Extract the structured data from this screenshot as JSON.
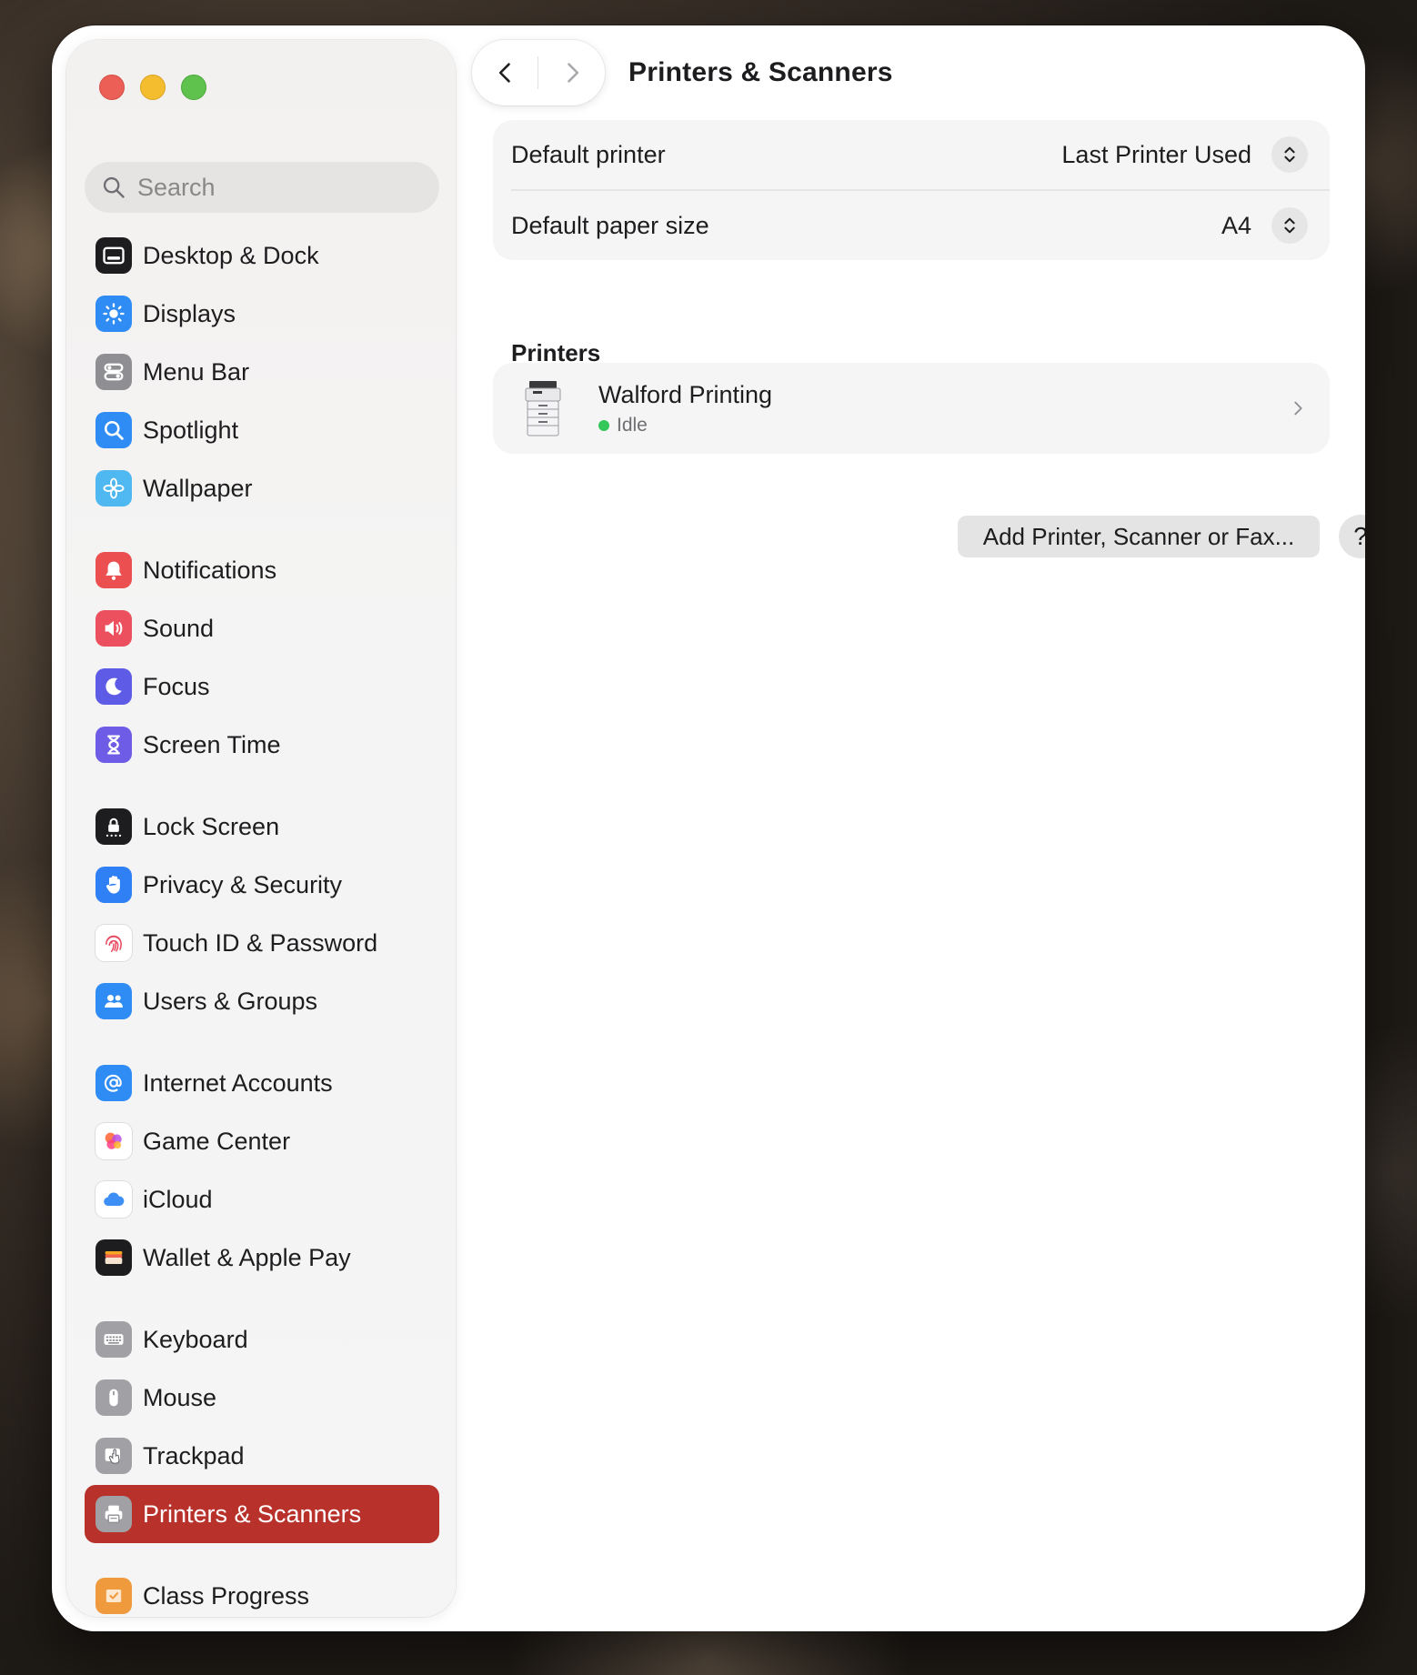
{
  "window": {
    "title": "Printers & Scanners"
  },
  "search": {
    "placeholder": "Search"
  },
  "sidebar": {
    "items": [
      {
        "label": "Desktop & Dock",
        "icon": "desktop-dock-icon",
        "color": "#1d1d1f"
      },
      {
        "label": "Displays",
        "icon": "displays-icon",
        "color": "#2f8cf5"
      },
      {
        "label": "Menu Bar",
        "icon": "menu-bar-icon",
        "color": "#8e8e93"
      },
      {
        "label": "Spotlight",
        "icon": "spotlight-icon",
        "color": "#2f8cf5"
      },
      {
        "label": "Wallpaper",
        "icon": "wallpaper-icon",
        "color": "#4fb8f0"
      },
      {
        "label": "Notifications",
        "icon": "notifications-icon",
        "color": "#ec4f4f"
      },
      {
        "label": "Sound",
        "icon": "sound-icon",
        "color": "#ec4f5d"
      },
      {
        "label": "Focus",
        "icon": "focus-icon",
        "color": "#5e5ce6"
      },
      {
        "label": "Screen Time",
        "icon": "screen-time-icon",
        "color": "#6e5ce6"
      },
      {
        "label": "Lock Screen",
        "icon": "lock-screen-icon",
        "color": "#1d1d1f"
      },
      {
        "label": "Privacy & Security",
        "icon": "privacy-hand-icon",
        "color": "#2f7ff5"
      },
      {
        "label": "Touch ID & Password",
        "icon": "fingerprint-icon",
        "color": "#ffffff"
      },
      {
        "label": "Users & Groups",
        "icon": "users-groups-icon",
        "color": "#2f8cf5"
      },
      {
        "label": "Internet Accounts",
        "icon": "at-sign-icon",
        "color": "#2f8cf5"
      },
      {
        "label": "Game Center",
        "icon": "game-center-icon",
        "color": "#ffffff"
      },
      {
        "label": "iCloud",
        "icon": "icloud-icon",
        "color": "#ffffff"
      },
      {
        "label": "Wallet & Apple Pay",
        "icon": "wallet-icon",
        "color": "#1d1d1f"
      },
      {
        "label": "Keyboard",
        "icon": "keyboard-icon",
        "color": "#a0a0a5"
      },
      {
        "label": "Mouse",
        "icon": "mouse-icon",
        "color": "#a0a0a5"
      },
      {
        "label": "Trackpad",
        "icon": "trackpad-icon",
        "color": "#a0a0a5"
      },
      {
        "label": "Printers & Scanners",
        "icon": "printer-icon",
        "color": "#a0a0a5",
        "selected": true
      },
      {
        "label": "Class Progress",
        "icon": "class-progress-icon",
        "color": "#f09a3e"
      }
    ]
  },
  "settings": {
    "default_printer": {
      "label": "Default printer",
      "value": "Last Printer Used"
    },
    "default_paper": {
      "label": "Default paper size",
      "value": "A4"
    }
  },
  "printers": {
    "section_title": "Printers",
    "list": [
      {
        "name": "Walford Printing",
        "status": "Idle",
        "status_color": "#34c759"
      }
    ]
  },
  "actions": {
    "add_label": "Add Printer, Scanner or Fax...",
    "help_label": "?"
  },
  "colors": {
    "accent": "#b8322b"
  }
}
